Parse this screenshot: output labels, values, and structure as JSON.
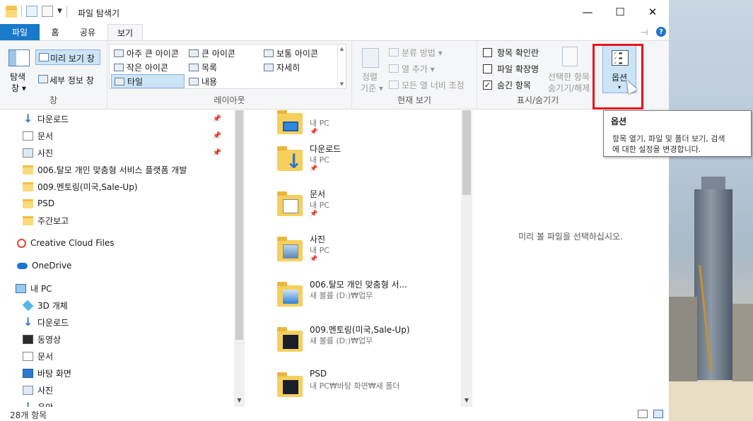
{
  "window": {
    "title": "파일 탐색기",
    "minimize_label": "—",
    "maximize_label": "☐",
    "close_label": "✕"
  },
  "tabs": [
    {
      "label": "파일"
    },
    {
      "label": "홈"
    },
    {
      "label": "공유"
    },
    {
      "label": "보기"
    }
  ],
  "ribbon": {
    "pane": {
      "nav_pane_label_1": "탐색",
      "nav_pane_label_2": "창 ▾",
      "preview_pane": "미리 보기 창",
      "details_pane": "세부 정보 창",
      "group": "창"
    },
    "layout": {
      "items": [
        "아주 큰 아이콘",
        "큰 아이콘",
        "보통 아이콘",
        "작은 아이콘",
        "목록",
        "자세히",
        "타일",
        "내용"
      ],
      "selected": "타일",
      "group": "레이아웃"
    },
    "current_view": {
      "sort_1": "정렬",
      "sort_2": "기준 ▾",
      "group_by": "분류 방법 ▾",
      "add_columns": "열 추가 ▾",
      "size_columns": "모든 열 너비 조정",
      "group": "현재 보기"
    },
    "show_hide": {
      "item_checkboxes": "항목 확인란",
      "item_checkboxes_checked": false,
      "file_extensions": "파일 확장명",
      "file_extensions_checked": false,
      "hidden_items": "숨긴 항목",
      "hidden_items_checked": true,
      "hide_selected_1": "선택한 항목",
      "hide_selected_2": "숨기기/해제",
      "group": "표시/숨기기"
    },
    "options": {
      "label": "옵션",
      "caret": "▾"
    }
  },
  "tooltip": {
    "title": "옵션",
    "desc_1": "항목 열기, 파일 및 폴더 보기, 검색",
    "desc_2": "에 대한 설정을 변경합니다."
  },
  "nav": [
    {
      "label": "다운로드",
      "icon": "download-icon",
      "pinned": true
    },
    {
      "label": "문서",
      "icon": "document-icon",
      "pinned": true
    },
    {
      "label": "사진",
      "icon": "pictures-icon",
      "pinned": true
    },
    {
      "label": "006.탈모 개인 맞춤형 서비스 플랫폼 개발",
      "icon": "folder-icon",
      "pinned": false
    },
    {
      "label": "009.멘토링(미국,Sale-Up)",
      "icon": "folder-icon",
      "pinned": false
    },
    {
      "label": "PSD",
      "icon": "folder-icon",
      "pinned": false
    },
    {
      "label": "주간보고",
      "icon": "folder-icon",
      "pinned": false
    },
    {
      "label": "Creative Cloud Files",
      "icon": "creative-cloud-icon",
      "pinned": false
    },
    {
      "label": "OneDrive",
      "icon": "onedrive-icon",
      "pinned": false
    },
    {
      "label": "내 PC",
      "icon": "this-pc-icon",
      "pinned": false
    },
    {
      "label": "3D 개체",
      "icon": "3d-objects-icon",
      "pinned": false
    },
    {
      "label": "다운로드",
      "icon": "download-icon",
      "pinned": false
    },
    {
      "label": "동영상",
      "icon": "video-icon",
      "pinned": false
    },
    {
      "label": "문서",
      "icon": "document-icon",
      "pinned": false
    },
    {
      "label": "바탕 화면",
      "icon": "desktop-icon",
      "pinned": false
    },
    {
      "label": "사진",
      "icon": "pictures-icon",
      "pinned": false
    },
    {
      "label": "음악",
      "icon": "music-icon",
      "pinned": false
    }
  ],
  "files": [
    {
      "name": "",
      "sub": "내 PC",
      "overlay": "desktop-icon"
    },
    {
      "name": "다운로드",
      "sub": "내 PC",
      "overlay": "download-icon"
    },
    {
      "name": "문서",
      "sub": "내 PC",
      "overlay": "document-icon"
    },
    {
      "name": "사진",
      "sub": "내 PC",
      "overlay": "pictures-icon"
    },
    {
      "name": "006.탈모 개인 맞춤형 서...",
      "sub": "새 볼륨 (D:)₩업무",
      "overlay": "image-folder-icon"
    },
    {
      "name": "009.멘토링(미국,Sale-Up)",
      "sub": "새 볼륨 (D:)₩업무",
      "overlay": "dark-image-folder-icon"
    },
    {
      "name": "PSD",
      "sub": "내 PC₩바탕 화면₩새 폴더",
      "overlay": "dark-image-folder-icon"
    }
  ],
  "preview": {
    "message": "미리 볼 파일을 선택하십시오."
  },
  "status": {
    "count": "28개 항목"
  },
  "colors": {
    "file_tab": "#1979ca",
    "selection": "#cce4f7",
    "highlight": "#e8141b"
  }
}
